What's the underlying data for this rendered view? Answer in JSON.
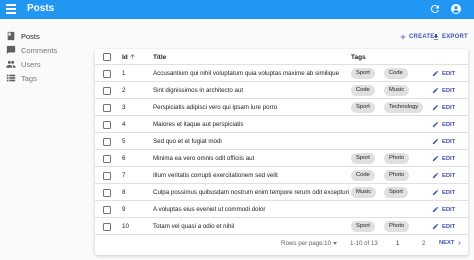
{
  "appbar": {
    "title": "Posts"
  },
  "sidebar": {
    "items": [
      {
        "label": "Posts",
        "icon": "book-icon",
        "active": true
      },
      {
        "label": "Comments",
        "icon": "comment-icon",
        "active": false
      },
      {
        "label": "Users",
        "icon": "people-icon",
        "active": false
      },
      {
        "label": "Tags",
        "icon": "list-icon",
        "active": false
      }
    ]
  },
  "toolbar": {
    "create_label": "CREATE",
    "export_label": "EXPORT"
  },
  "table": {
    "columns": {
      "id": "Id",
      "title": "Title",
      "tags": "Tags"
    },
    "edit_label": "EDIT",
    "rows": [
      {
        "id": "1",
        "title": "Accusantium qui nihil voluptatum quia voluptas maxime ab similique",
        "tags": [
          "Sport",
          "Code"
        ]
      },
      {
        "id": "2",
        "title": "Sint dignissimos in architecto aut",
        "tags": [
          "Code",
          "Music"
        ]
      },
      {
        "id": "3",
        "title": "Perspiciatis adipisci vero qui ipsam iure porro",
        "tags": [
          "Sport",
          "Technology"
        ]
      },
      {
        "id": "4",
        "title": "Maiores et itaque aut perspiciatis",
        "tags": []
      },
      {
        "id": "5",
        "title": "Sed quo et et fugiat modi",
        "tags": []
      },
      {
        "id": "6",
        "title": "Minima ea vero omnis odit officiis aut",
        "tags": [
          "Sport",
          "Photo"
        ]
      },
      {
        "id": "7",
        "title": "Illum veritatis corrupti exercitationem sed velit",
        "tags": [
          "Code",
          "Photo"
        ]
      },
      {
        "id": "8",
        "title": "Culpa possimus quibusdam nostrum enim tempore rerum odit excepturi",
        "tags": [
          "Music",
          "Sport"
        ]
      },
      {
        "id": "9",
        "title": "A voluptas eius eveniet ut commodi dolor",
        "tags": []
      },
      {
        "id": "10",
        "title": "Totam vel quasi a odio et nihil",
        "tags": [
          "Sport",
          "Photo"
        ]
      }
    ]
  },
  "pagination": {
    "rows_per_page_label": "Rows per page:",
    "rows_per_page_value": "10",
    "range": "1-10 of 13",
    "page_1": "1",
    "page_2": "2",
    "next_label": "NEXT"
  },
  "colors": {
    "appbar": "#2196f3",
    "accent": "#3f51b5",
    "chip": "#e0e0e0"
  }
}
